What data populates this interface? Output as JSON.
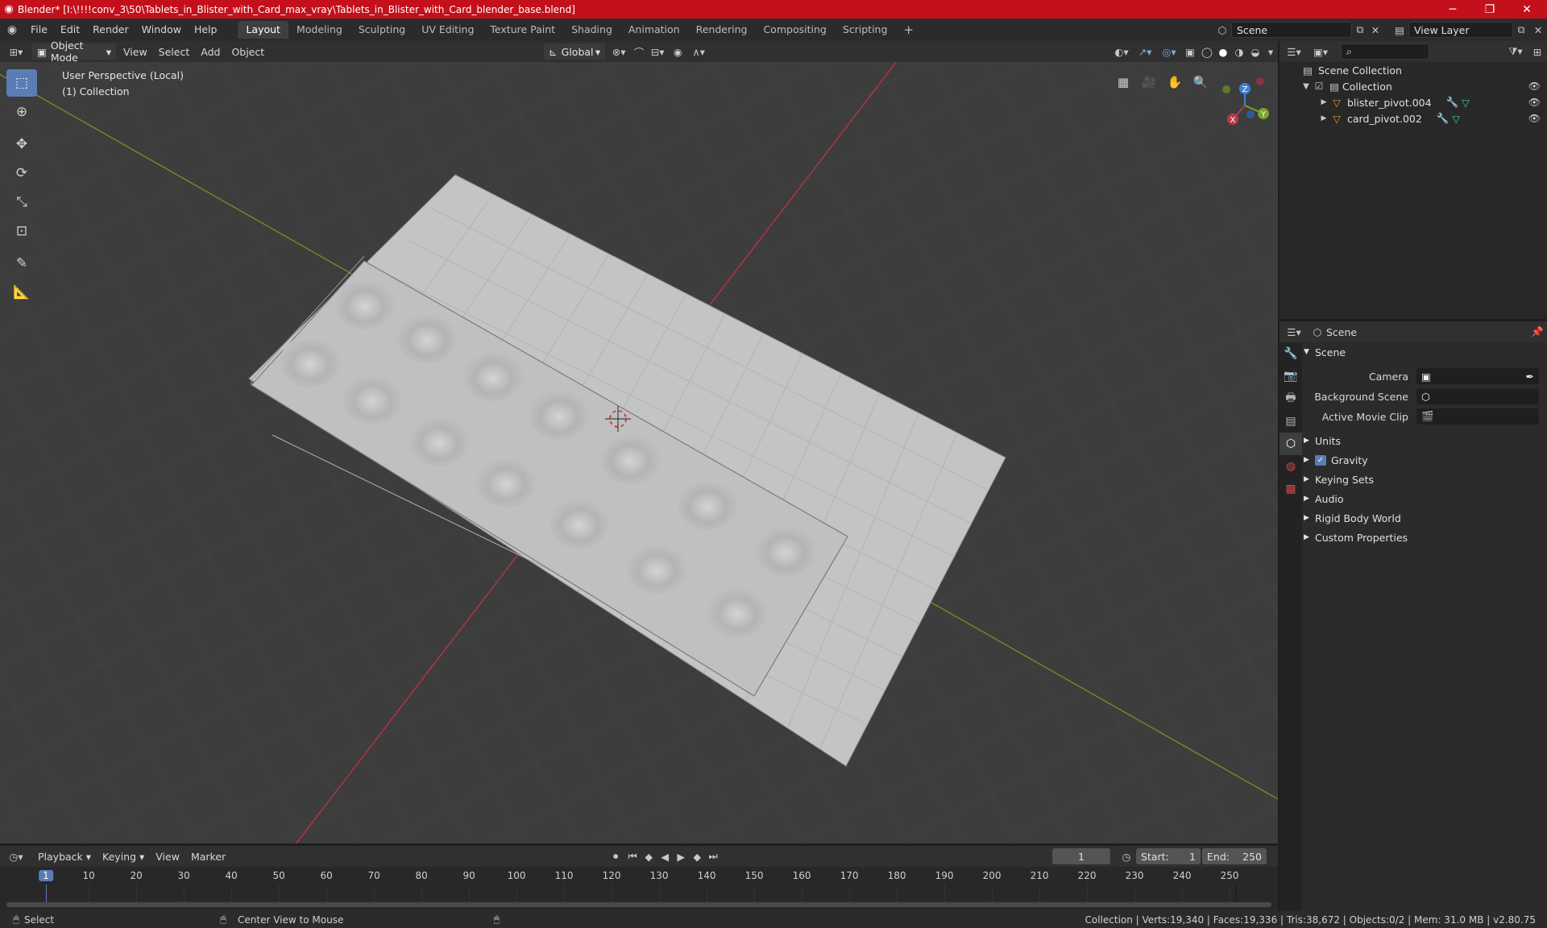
{
  "window": {
    "title": "Blender* [I:\\!!!!conv_3\\50\\Tablets_in_Blister_with_Card_max_vray\\Tablets_in_Blister_with_Card_blender_base.blend]"
  },
  "menus": [
    "File",
    "Edit",
    "Render",
    "Window",
    "Help"
  ],
  "workspaces": [
    {
      "label": "Layout",
      "active": true
    },
    {
      "label": "Modeling"
    },
    {
      "label": "Sculpting"
    },
    {
      "label": "UV Editing"
    },
    {
      "label": "Texture Paint"
    },
    {
      "label": "Shading"
    },
    {
      "label": "Animation"
    },
    {
      "label": "Rendering"
    },
    {
      "label": "Compositing"
    },
    {
      "label": "Scripting"
    }
  ],
  "scene_selector": {
    "value": "Scene"
  },
  "view_layer_selector": {
    "value": "View Layer"
  },
  "viewport_header": {
    "mode": "Object Mode",
    "view": "View",
    "select": "Select",
    "add": "Add",
    "object": "Object",
    "transform_orientation": "Global"
  },
  "viewport": {
    "perspective_label": "User Perspective (Local)",
    "collection_label": "(1) Collection",
    "gizmo": {
      "x": "X",
      "y": "Y",
      "z": "Z"
    }
  },
  "outliner": {
    "root": "Scene Collection",
    "collection": "Collection",
    "objects": [
      "blister_pivot.004",
      "card_pivot.002"
    ]
  },
  "properties": {
    "header": "Scene",
    "section": "Scene",
    "fields": [
      {
        "label": "Camera"
      },
      {
        "label": "Background Scene"
      },
      {
        "label": "Active Movie Clip"
      }
    ],
    "panels": [
      "Units",
      "Gravity",
      "Keying Sets",
      "Audio",
      "Rigid Body World",
      "Custom Properties"
    ]
  },
  "timeline": {
    "menus": [
      "Playback",
      "Keying",
      "View",
      "Marker"
    ],
    "current_frame": "1",
    "start_label": "Start:",
    "start": "1",
    "end_label": "End:",
    "end": "250",
    "ticks": [
      "1",
      "10",
      "20",
      "30",
      "40",
      "50",
      "60",
      "70",
      "80",
      "90",
      "100",
      "110",
      "120",
      "130",
      "140",
      "150",
      "160",
      "170",
      "180",
      "190",
      "200",
      "210",
      "220",
      "230",
      "240",
      "250"
    ]
  },
  "statusbar": {
    "select": "Select",
    "center_view": "Center View to Mouse",
    "stats": "Collection | Verts:19,340 | Faces:19,336 | Tris:38,672 | Objects:0/2 | Mem: 31.0 MB | v2.80.75"
  },
  "colors": {
    "title_bar": "#c4101b",
    "accent": "#5a7db5",
    "x_axis": "#b83a48",
    "y_axis": "#7ea22a",
    "z_axis": "#3f7fd6"
  }
}
